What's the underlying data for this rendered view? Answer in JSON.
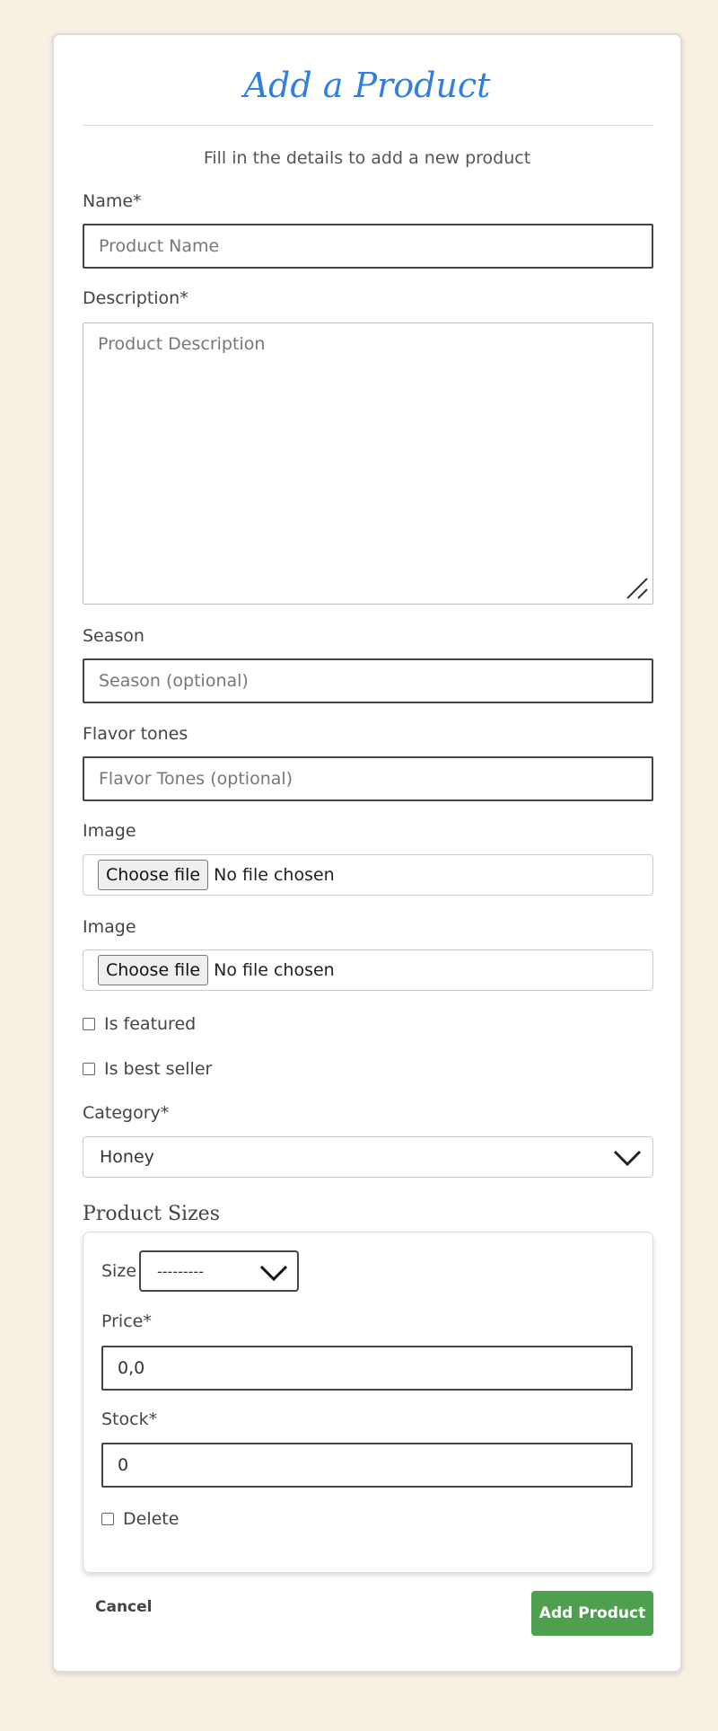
{
  "form": {
    "title": "Add a Product",
    "subtitle": "Fill in the details to add a new product",
    "name": {
      "label": "Name*",
      "placeholder": "Product Name"
    },
    "description": {
      "label": "Description*",
      "placeholder": "Product Description"
    },
    "season": {
      "label": "Season",
      "placeholder": "Season (optional)"
    },
    "flavor_tones": {
      "label": "Flavor tones",
      "placeholder": "Flavor Tones (optional)"
    },
    "image1": {
      "label": "Image",
      "button": "Choose file",
      "status": "No file chosen"
    },
    "image2": {
      "label": "Image",
      "button": "Choose file",
      "status": "No file chosen"
    },
    "is_featured": {
      "label": "Is featured",
      "checked": false
    },
    "is_best_seller": {
      "label": "Is best seller",
      "checked": false
    },
    "category": {
      "label": "Category*",
      "value": "Honey"
    }
  },
  "sizes": {
    "title": "Product Sizes",
    "size": {
      "label": "Size",
      "value": "---------"
    },
    "price": {
      "label": "Price*",
      "value": "0,0"
    },
    "stock": {
      "label": "Stock*",
      "value": "0"
    },
    "delete": {
      "label": "Delete",
      "checked": false
    }
  },
  "actions": {
    "cancel": "Cancel",
    "submit": "Add Product"
  },
  "colors": {
    "page_bg": "#f8f0e2",
    "title": "#2f7fe0",
    "submit_bg": "#4ea04e"
  }
}
